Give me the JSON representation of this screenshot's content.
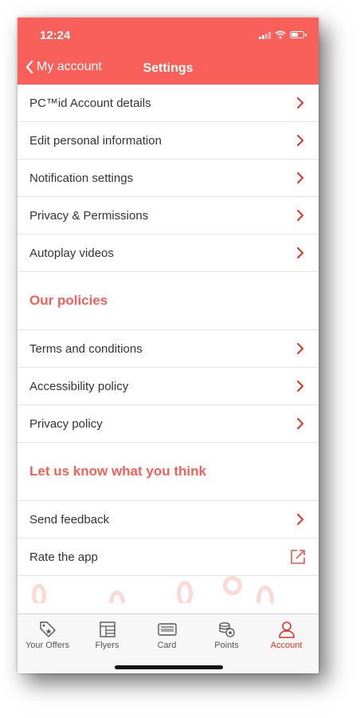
{
  "status": {
    "time": "12:24"
  },
  "header": {
    "back_label": "My account",
    "title": "Settings"
  },
  "settings_items": [
    {
      "label": "PC™id Account details"
    },
    {
      "label": "Edit personal information"
    },
    {
      "label": "Notification settings"
    },
    {
      "label": "Privacy & Permissions"
    },
    {
      "label": "Autoplay videos"
    }
  ],
  "policies": {
    "heading": "Our policies",
    "items": [
      {
        "label": "Terms and conditions"
      },
      {
        "label": "Accessibility policy"
      },
      {
        "label": "Privacy policy"
      }
    ]
  },
  "feedback": {
    "heading": "Let us know what you think",
    "items": [
      {
        "label": "Send feedback",
        "icon": "chevron-right-icon"
      },
      {
        "label": "Rate the app",
        "icon": "external-link-icon"
      }
    ]
  },
  "tabs": [
    {
      "label": "Your Offers",
      "icon": "tag-star-icon",
      "active": false
    },
    {
      "label": "Flyers",
      "icon": "flyer-icon",
      "active": false
    },
    {
      "label": "Card",
      "icon": "card-icon",
      "active": false
    },
    {
      "label": "Points",
      "icon": "coins-icon",
      "active": false
    },
    {
      "label": "Account",
      "icon": "person-icon",
      "active": true
    }
  ],
  "colors": {
    "brand": "#f9605a",
    "accent_text": "#f06259",
    "active_tab": "#d9352b"
  }
}
